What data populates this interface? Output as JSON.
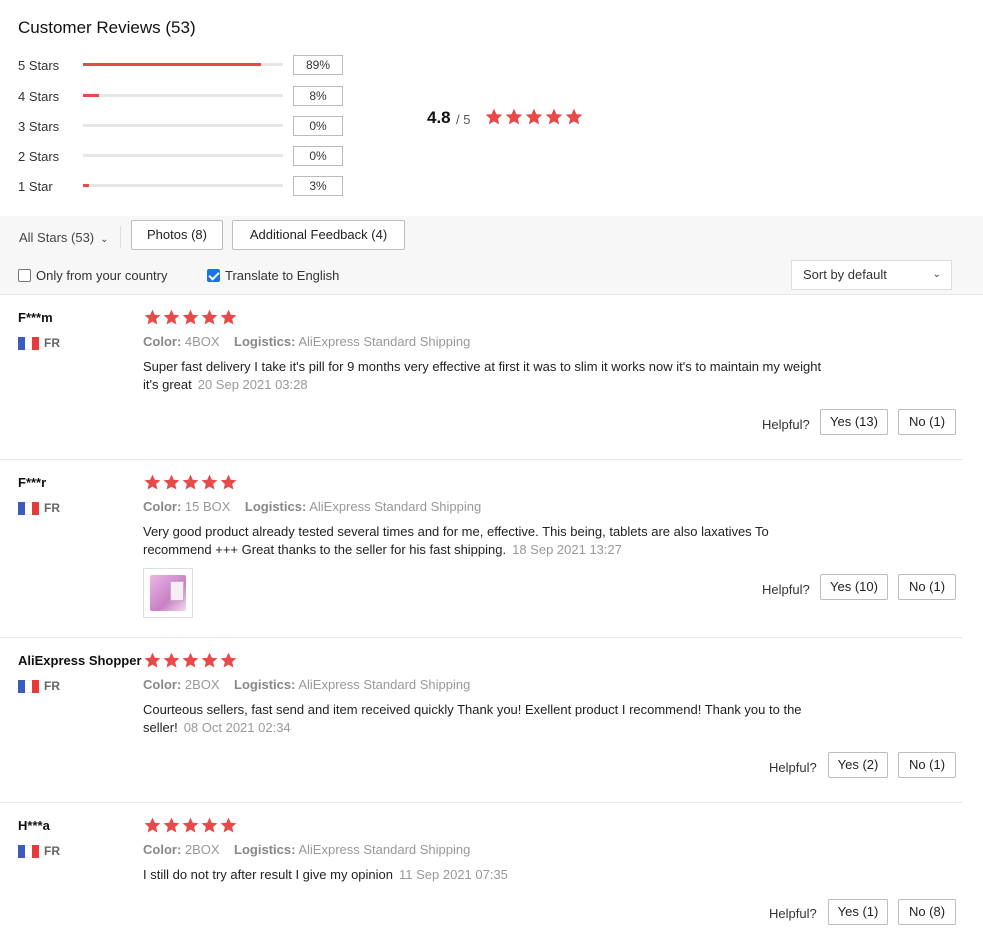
{
  "title": "Customer Reviews (53)",
  "distribution": [
    {
      "label": "5 Stars",
      "pct": "89%",
      "fill": 0.89
    },
    {
      "label": "4 Stars",
      "pct": "8%",
      "fill": 0.08
    },
    {
      "label": "3 Stars",
      "pct": "0%",
      "fill": 0.0
    },
    {
      "label": "2 Stars",
      "pct": "0%",
      "fill": 0.0
    },
    {
      "label": "1 Star",
      "pct": "3%",
      "fill": 0.03
    }
  ],
  "average": {
    "value": "4.8",
    "of": "/ 5",
    "stars": 5
  },
  "colors": {
    "star": "#e84a4a",
    "bar": "#e84a4a",
    "checkbox": "#1a73e8"
  },
  "filters": {
    "all_stars": "All Stars (53)",
    "photos": "Photos (8)",
    "additional": "Additional Feedback (4)",
    "only_country": "Only from your country",
    "only_country_checked": false,
    "translate": "Translate to English",
    "translate_checked": true,
    "sort": "Sort by default"
  },
  "reviews": [
    {
      "user": "F***m",
      "country": "FR",
      "stars": 5,
      "color_label": "Color:",
      "color": "4BOX",
      "logistics_label": "Logistics:",
      "logistics": "AliExpress Standard Shipping",
      "text_line1": "Super fast delivery I take it's pill for 9 months very effective at first it was to slim it works now it's to maintain my weight",
      "text_line2": "it's great",
      "date": "20 Sep 2021 03:28",
      "helpful": "Helpful?",
      "yes": "Yes (13)",
      "no": "No (1)"
    },
    {
      "user": "F***r",
      "country": "FR",
      "stars": 5,
      "color_label": "Color:",
      "color": "15 BOX",
      "logistics_label": "Logistics:",
      "logistics": "AliExpress Standard Shipping",
      "text_line1": "Very good product already tested several times and for me, effective. This being, tablets are also laxatives To",
      "text_line2": "recommend +++ Great thanks to the seller for his fast shipping.",
      "date": "18 Sep 2021 13:27",
      "has_photo": true,
      "helpful": "Helpful?",
      "yes": "Yes (10)",
      "no": "No (1)"
    },
    {
      "user": "AliExpress Shopper",
      "country": "FR",
      "stars": 5,
      "color_label": "Color:",
      "color": "2BOX",
      "logistics_label": "Logistics:",
      "logistics": "AliExpress Standard Shipping",
      "text_line1": "Courteous sellers, fast send and item received quickly Thank you! Exellent product I recommend! Thank you to the",
      "text_line2": "seller!",
      "date": "08 Oct 2021 02:34",
      "helpful": "Helpful?",
      "yes": "Yes (2)",
      "no": "No (1)"
    },
    {
      "user": "H***a",
      "country": "FR",
      "stars": 5,
      "color_label": "Color:",
      "color": "2BOX",
      "logistics_label": "Logistics:",
      "logistics": "AliExpress Standard Shipping",
      "text_line1": "I still do not try after result I give my opinion",
      "text_line2": "",
      "date": "11 Sep 2021 07:35",
      "helpful": "Helpful?",
      "yes": "Yes (1)",
      "no": "No (8)"
    }
  ]
}
